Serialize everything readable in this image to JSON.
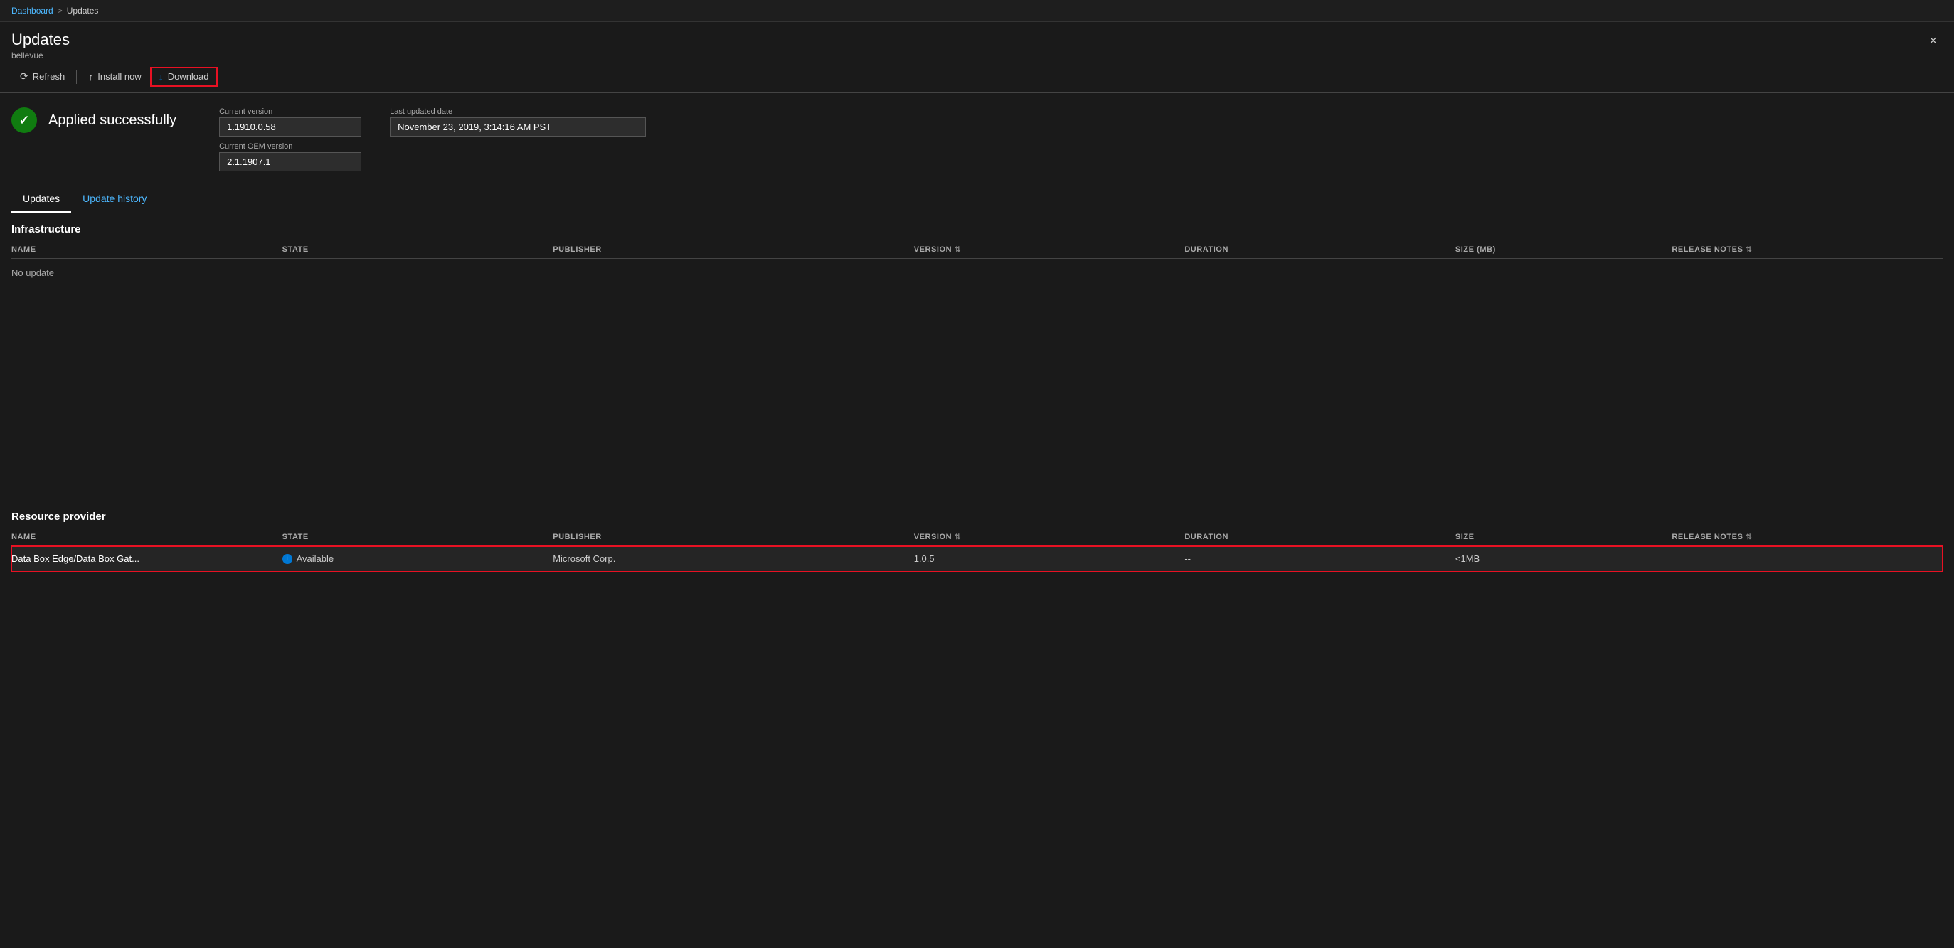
{
  "breadcrumb": {
    "parent": "Dashboard",
    "separator": ">",
    "current": "Updates"
  },
  "header": {
    "title": "Updates",
    "subtitle": "bellevue",
    "close_label": "×"
  },
  "toolbar": {
    "refresh_label": "Refresh",
    "install_label": "Install now",
    "download_label": "Download"
  },
  "status": {
    "icon": "✓",
    "text": "Applied successfully",
    "current_version_label": "Current version",
    "current_version_value": "1.1910.0.58",
    "current_oem_label": "Current OEM version",
    "current_oem_value": "2.1.1907.1",
    "last_updated_label": "Last updated date",
    "last_updated_value": "November 23, 2019, 3:14:16 AM PST"
  },
  "tabs": [
    {
      "label": "Updates",
      "active": true
    },
    {
      "label": "Update history",
      "active": false
    }
  ],
  "infrastructure": {
    "section_title": "Infrastructure",
    "columns": {
      "name": "NAME",
      "state": "STATE",
      "publisher": "PUBLISHER",
      "version": "VERSION",
      "duration": "DURATION",
      "size": "SIZE (MB)",
      "release_notes": "RELEASE NOTES"
    },
    "rows": [],
    "empty_message": "No update"
  },
  "resource_provider": {
    "section_title": "Resource provider",
    "columns": {
      "name": "NAME",
      "state": "STATE",
      "publisher": "PUBLISHER",
      "version": "VERSION",
      "duration": "DURATION",
      "size": "SIZE",
      "release_notes": "RELEASE NOTES"
    },
    "rows": [
      {
        "name": "Data Box Edge/Data Box Gat...",
        "state": "Available",
        "publisher": "Microsoft Corp.",
        "version": "1.0.5",
        "duration": "--",
        "size": "<1MB",
        "release_notes": "",
        "selected": true
      }
    ]
  }
}
